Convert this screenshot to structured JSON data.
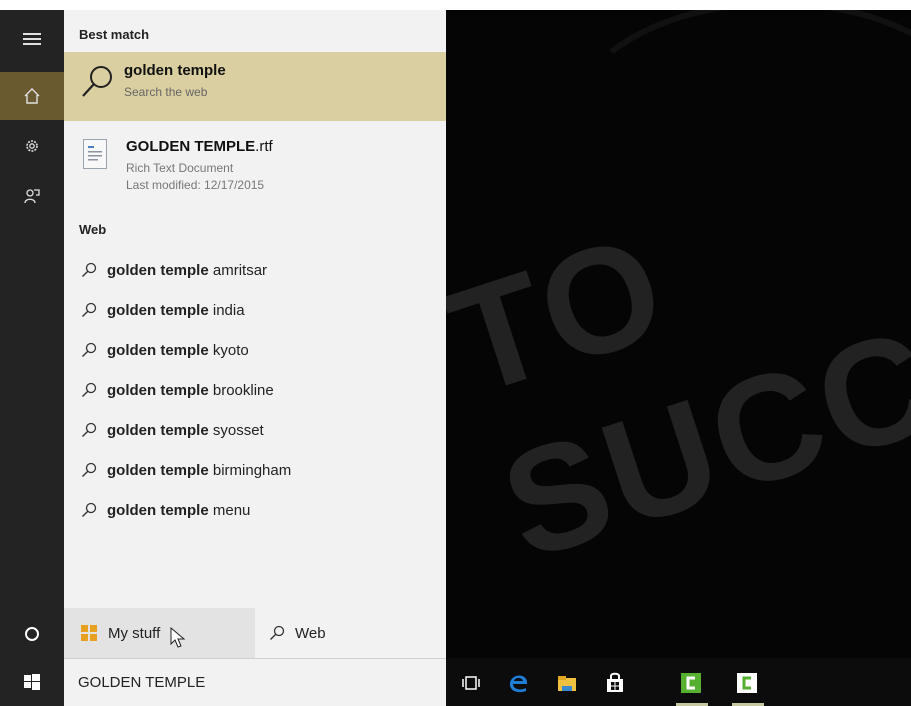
{
  "rail": {
    "items": [
      {
        "name": "hamburger-menu-icon",
        "glyph": "☰"
      },
      {
        "name": "home-icon",
        "glyph": "⌂"
      },
      {
        "name": "settings-gear-icon",
        "glyph": "⚙"
      },
      {
        "name": "feedback-icon",
        "glyph": "✉"
      }
    ],
    "bottom_glyph": "○"
  },
  "best_match": {
    "label": "Best match",
    "title": "golden temple",
    "subtitle": "Search the web"
  },
  "document": {
    "name": "GOLDEN TEMPLE",
    "ext": ".rtf",
    "type": "Rich Text Document",
    "modified": "Last modified: 12/17/2015"
  },
  "web": {
    "label": "Web",
    "query": "golden temple",
    "suggestions": [
      {
        "bold": "golden temple",
        "rest": " amritsar"
      },
      {
        "bold": "golden temple",
        "rest": " india"
      },
      {
        "bold": "golden temple",
        "rest": " kyoto"
      },
      {
        "bold": "golden temple",
        "rest": " brookline"
      },
      {
        "bold": "golden temple",
        "rest": " syosset"
      },
      {
        "bold": "golden temple",
        "rest": " birmingham"
      },
      {
        "bold": "golden temple",
        "rest": " menu"
      }
    ]
  },
  "tabs": {
    "my_stuff": "My stuff",
    "web": "Web"
  },
  "search_box": {
    "value": "GOLDEN TEMPLE"
  },
  "colors": {
    "highlight": "#d9cfa0",
    "rail_active": "#6a5a30",
    "edge_blue": "#1f7fd6",
    "camtasia_green": "#55b030"
  }
}
